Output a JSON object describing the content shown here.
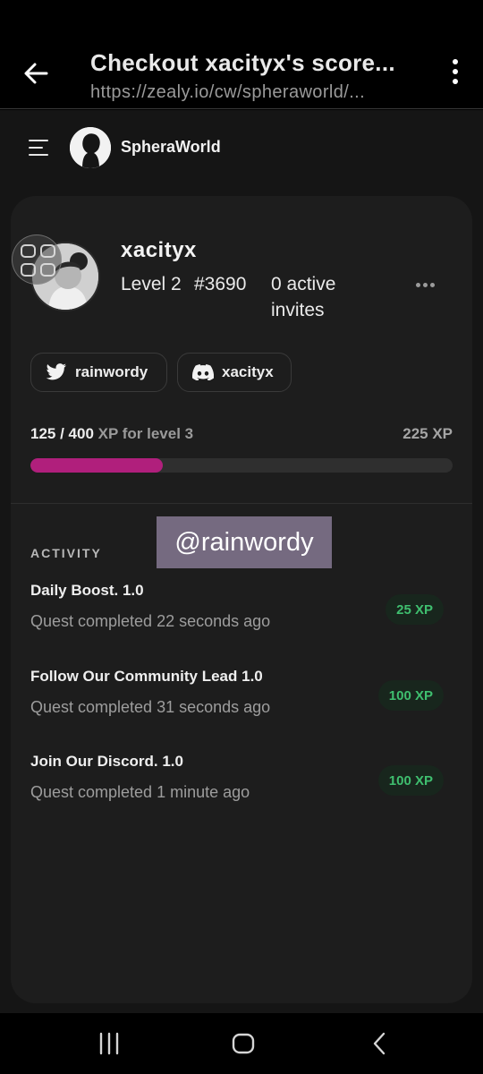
{
  "browser": {
    "title": "Checkout xacityx's score...",
    "url": "https://zealy.io/cw/spheraworld/..."
  },
  "header": {
    "brand_name": "SpheraWorld",
    "icons": [
      "menu-icon",
      "brand-logo"
    ]
  },
  "profile": {
    "username": "xacityx",
    "level": "Level 2",
    "rank": "#3690",
    "invites": "0 active invites",
    "socials": [
      {
        "network": "twitter",
        "handle": "rainwordy"
      },
      {
        "network": "discord",
        "handle": "xacityx"
      }
    ]
  },
  "xp": {
    "current": "125",
    "separator": " / ",
    "target": "400",
    "label": " XP for level 3",
    "remaining": "225 XP",
    "progress_fraction": 0.3125,
    "progress_color": "#b01f7c"
  },
  "activity": {
    "title": "ACTIVITY",
    "items": [
      {
        "name": "Daily Boost. 1.0",
        "time": "Quest completed 22 seconds ago",
        "xp": "25 XP"
      },
      {
        "name": "Follow Our Community Lead 1.0",
        "time": "Quest completed 31 seconds ago",
        "xp": "100 XP"
      },
      {
        "name": "Join Our Discord. 1.0",
        "time": "Quest completed 1 minute ago",
        "xp": "100 XP"
      }
    ]
  },
  "watermark": "@rainwordy",
  "colors": {
    "background": "#151515",
    "card": "#1d1d1d",
    "xp_badge_text": "#3fbf6f",
    "xp_badge_bg": "#18261d"
  }
}
